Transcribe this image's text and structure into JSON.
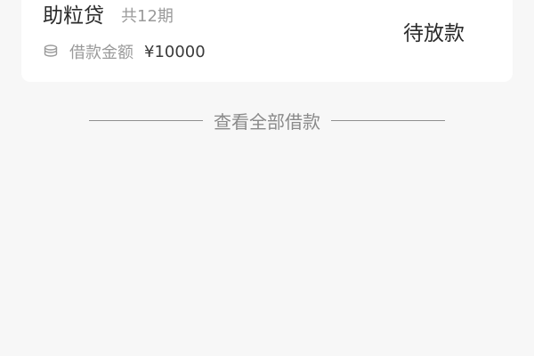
{
  "loan": {
    "product_name": "助粒贷",
    "term": "共12期",
    "status": "待放款",
    "amount_label": "借款金额",
    "amount_value": "¥10000",
    "icon": "coin-stack-icon"
  },
  "footer": {
    "view_all_label": "查看全部借款"
  },
  "colors": {
    "background": "#f7f7f7",
    "card": "#ffffff",
    "primary_text": "#2b2b2b",
    "secondary_text": "#9a9a9a"
  }
}
